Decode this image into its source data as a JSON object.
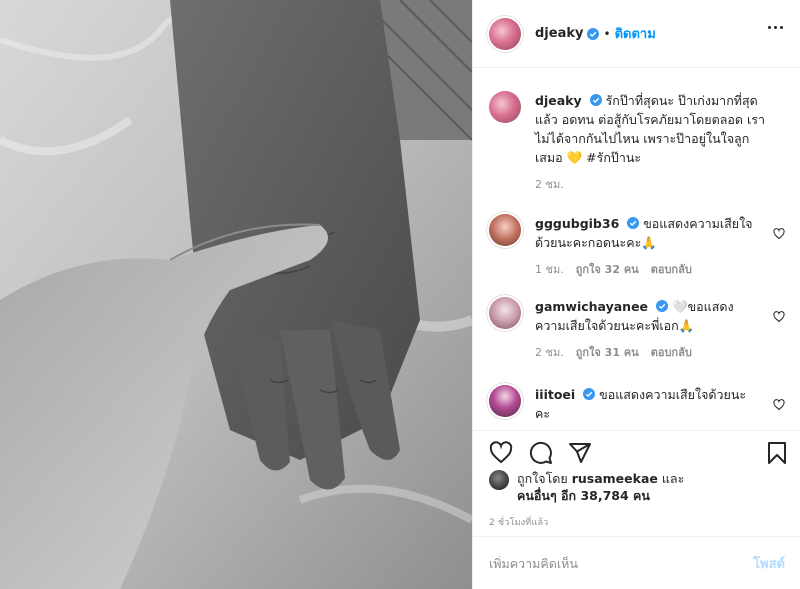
{
  "post": {
    "image_alt": "black and white photo of two hands holding"
  },
  "header": {
    "username": "djeaky",
    "separator": "•",
    "follow_label": "ติดตาม"
  },
  "caption": {
    "username": "djeaky",
    "text": "รักป๊าที่สุดนะ ป๊าเก่งมากที่สุดแล้ว อดทน ต่อสู้กับโรคภัยมาโดยตลอด เราไม่ได้จากกันไปไหน เพราะป๊าอยู่ในใจลูกเสมอ 💛 #รักป๊านะ",
    "time": "2 ชม."
  },
  "comments": [
    {
      "username": "gggubgib36",
      "text": "ขอแสดงความเสียใจด้วยนะคะกอดนะคะ🙏",
      "time": "1 ชม.",
      "likes": "ถูกใจ 32 คน",
      "reply": "ตอบกลับ"
    },
    {
      "username": "gamwichayanee",
      "text": "🤍ขอแสดงความเสียใจด้วยนะคะพี่เอก🙏",
      "time": "2 ชม.",
      "likes": "ถูกใจ 31 คน",
      "reply": "ตอบกลับ"
    },
    {
      "username": "iiitoei",
      "text": "ขอแสดงความเสียใจด้วยนะคะ",
      "time": "",
      "likes": "",
      "reply": ""
    }
  ],
  "likes": {
    "prefix": "ถูกใจโดย",
    "user": "rusameekae",
    "middle": "และ",
    "others": "คนอื่นๆ อีก 38,784 คน"
  },
  "timestamp": "2 ชั่วโมงที่แล้ว",
  "add_comment": {
    "placeholder": "เพิ่มความคิดเห็น",
    "post_label": "โพสต์"
  },
  "colors": {
    "accent": "#0095f6",
    "verified": "#3897f0",
    "muted": "#8e8e8e",
    "post_disabled": "#b3dbff"
  },
  "icons": [
    "heart-icon",
    "comment-icon",
    "share-icon",
    "bookmark-icon",
    "more-icon",
    "verified-icon"
  ]
}
